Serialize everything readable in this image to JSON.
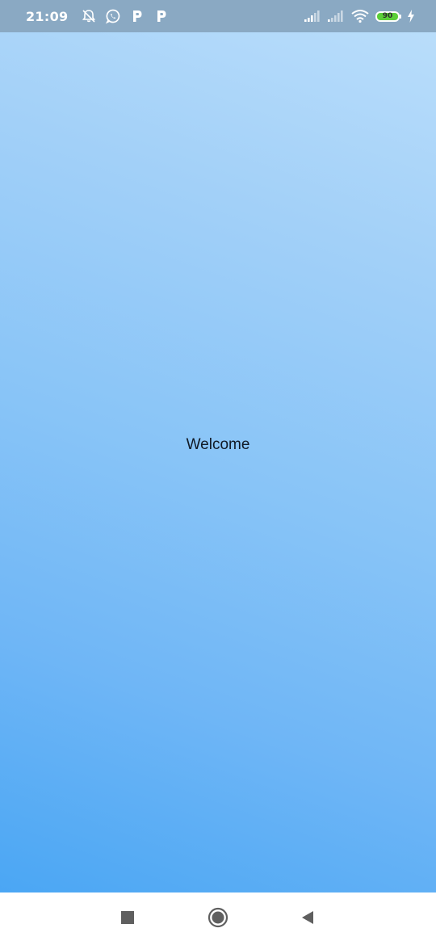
{
  "status_bar": {
    "time": "21:09",
    "battery_level": "90",
    "left_icons": [
      "alarm-off-icon",
      "whatsapp-icon",
      "parking-icon",
      "parking-icon"
    ],
    "right_icons": [
      "signal-icon",
      "signal-icon",
      "wifi-icon",
      "battery-icon",
      "charging-icon"
    ],
    "background": "#8aa9c3",
    "battery_color": "#5ccf3a"
  },
  "main": {
    "welcome_text": "Welcome",
    "gradient_top": "#bcdffb",
    "gradient_bottom": "#43a3f3"
  },
  "nav_bar": {
    "buttons": [
      "recent-apps-icon",
      "home-icon",
      "back-icon"
    ]
  }
}
